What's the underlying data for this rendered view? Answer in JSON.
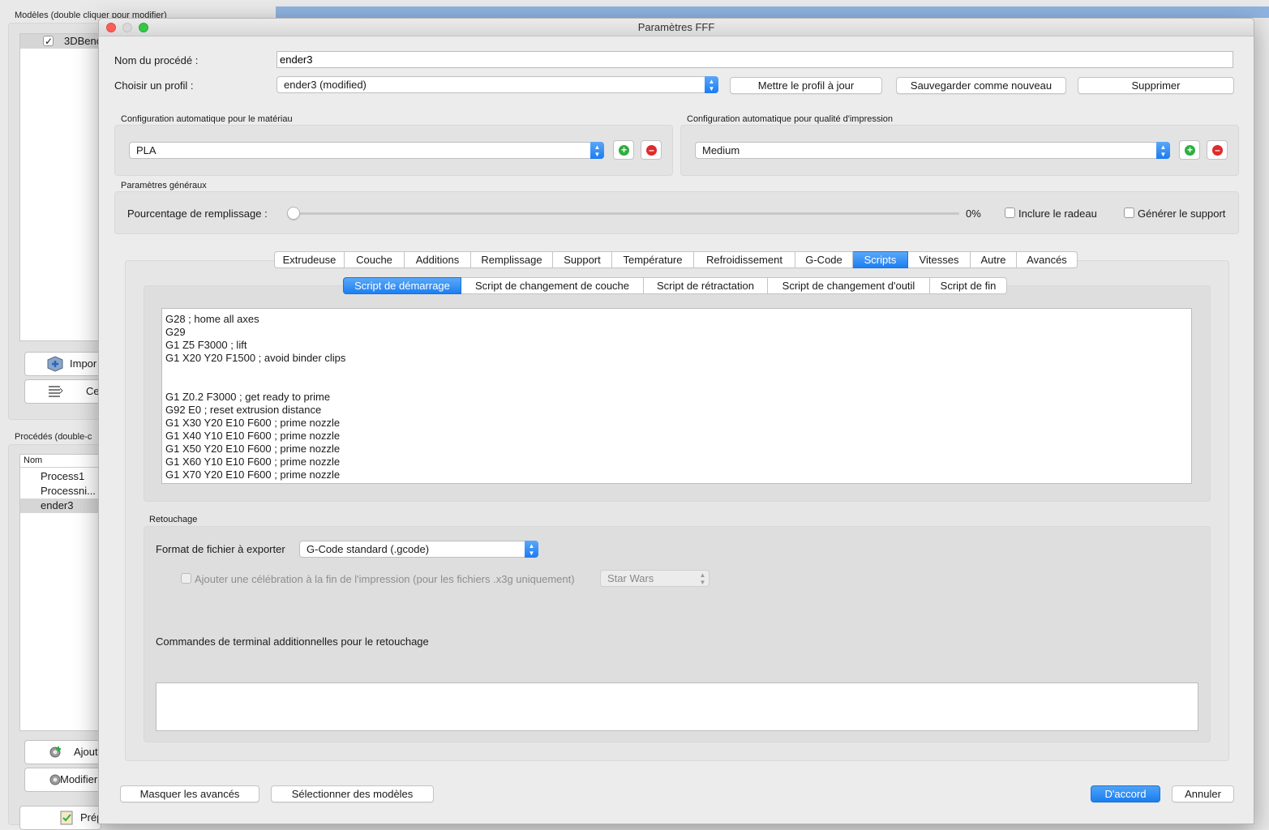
{
  "background": {
    "models_label": "Modèles (double cliquer pour modifier)",
    "model_item": "3DBenc",
    "import_button": "Impor",
    "center_button": "Ce",
    "processes_label": "Procédés (double-c",
    "process_column": "Nom",
    "processes": [
      "Process1",
      "Processni...",
      "ender3"
    ],
    "add_button": "Ajout",
    "modify_button": "Modifier",
    "prepare_button": "Prép"
  },
  "dialog": {
    "title": "Paramètres FFF",
    "process_name_label": "Nom du procédé :",
    "process_name_value": "ender3",
    "profile_label": "Choisir un profil :",
    "profile_value": "ender3 (modified)",
    "update_profile": "Mettre le profil à jour",
    "save_as_new": "Sauvegarder comme nouveau",
    "delete": "Supprimer",
    "material_group_label": "Configuration automatique pour le matériau",
    "material_value": "PLA",
    "quality_group_label": "Configuration automatique pour qualité d'impression",
    "quality_value": "Medium",
    "general_label": "Paramètres généraux",
    "infill_label": "Pourcentage de remplissage :",
    "infill_value_text": "0%",
    "infill_fraction": 0,
    "raft_label": "Inclure le radeau",
    "support_label": "Générer le support",
    "tabs": [
      "Extrudeuse",
      "Couche",
      "Additions",
      "Remplissage",
      "Support",
      "Température",
      "Refroidissement",
      "G-Code",
      "Scripts",
      "Vitesses",
      "Autre",
      "Avancés"
    ],
    "active_tab": "Scripts",
    "subtabs": [
      "Script de démarrage",
      "Script de changement de couche",
      "Script de rétractation",
      "Script de changement d'outil",
      "Script de fin"
    ],
    "active_subtab": "Script de démarrage",
    "script_lines": [
      "G28 ; home all axes",
      "G29",
      "G1 Z5 F3000 ; lift",
      "G1 X20 Y20 F1500 ; avoid binder clips",
      "",
      "",
      "G1 Z0.2 F3000 ; get ready to prime",
      "G92 E0 ; reset extrusion distance",
      "G1 X30 Y20 E10 F600 ; prime nozzle",
      "G1 X40 Y10 E10 F600 ; prime nozzle",
      "G1 X50 Y20 E10 F600 ; prime nozzle",
      "G1 X60 Y10 E10 F600 ; prime nozzle",
      "G1 X70 Y20 E10 F600 ; prime nozzle"
    ],
    "postprocess_label": "Retouchage",
    "export_format_label": "Format de fichier à exporter",
    "export_format_value": "G-Code standard (.gcode)",
    "celebration_label": "Ajouter une célébration à la fin de l'impression (pour les fichiers .x3g uniquement)",
    "celebration_value": "Star Wars",
    "terminal_label": "Commandes de terminal additionnelles pour le retouchage",
    "hide_advanced": "Masquer les avancés",
    "select_models": "Sélectionner des modèles",
    "ok": "D'accord",
    "cancel": "Annuler"
  }
}
